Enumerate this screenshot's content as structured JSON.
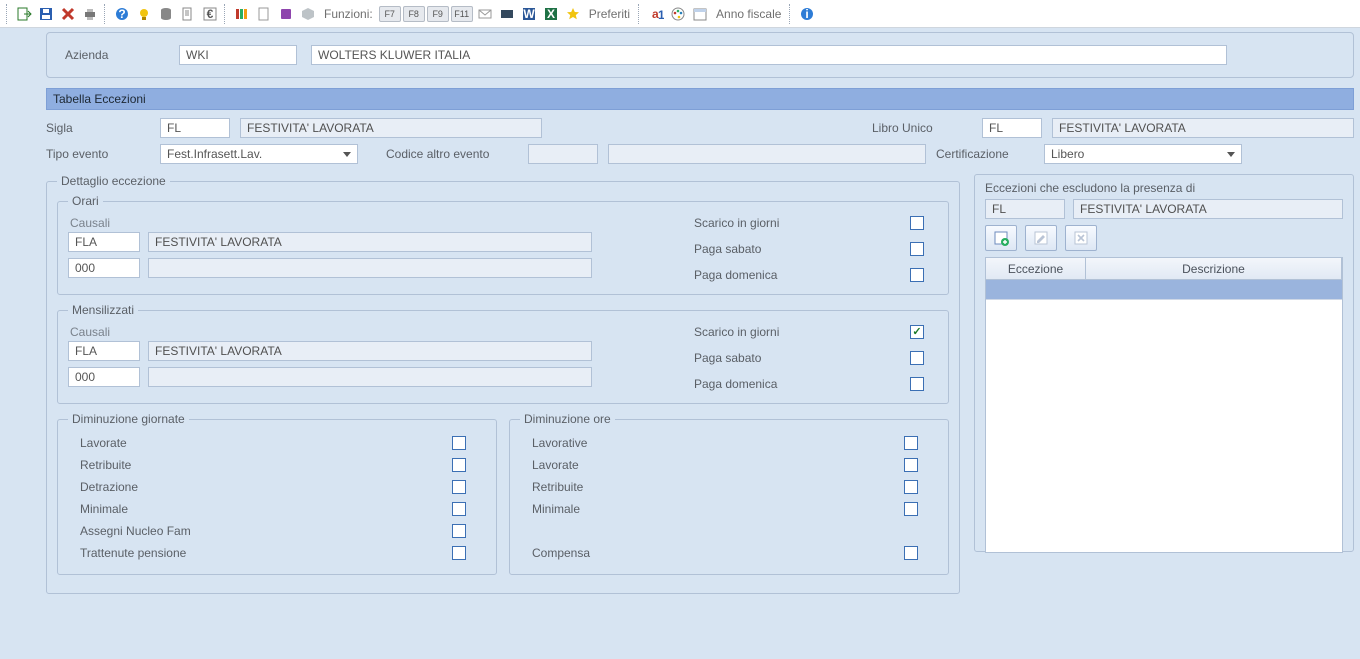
{
  "toolbar": {
    "funzioni_label": "Funzioni:",
    "keys": [
      "F7",
      "F8",
      "F9",
      "F11"
    ],
    "preferiti_label": "Preferiti",
    "anno_fiscale_label": "Anno fiscale"
  },
  "company": {
    "azienda_label": "Azienda",
    "azienda_code": "WKI",
    "azienda_name": "WOLTERS KLUWER ITALIA"
  },
  "section_title": "Tabella Eccezioni",
  "header": {
    "sigla_label": "Sigla",
    "sigla_value": "FL",
    "sigla_desc": "FESTIVITA' LAVORATA",
    "libro_unico_label": "Libro Unico",
    "libro_unico_value": "FL",
    "libro_unico_desc": "FESTIVITA' LAVORATA",
    "tipo_evento_label": "Tipo evento",
    "tipo_evento_value": "Fest.Infrasett.Lav.",
    "codice_altro_label": "Codice altro evento",
    "certificazione_label": "Certificazione",
    "certificazione_value": "Libero"
  },
  "dettaglio": {
    "legend": "Dettaglio eccezione",
    "orari": {
      "legend": "Orari",
      "causali_label": "Causali",
      "row1_code": "FLA",
      "row1_desc": "FESTIVITA' LAVORATA",
      "row2_code": "000",
      "row2_desc": "",
      "scarico_label": "Scarico in giorni",
      "scarico_checked": false,
      "paga_sabato_label": "Paga sabato",
      "paga_sabato_checked": false,
      "paga_domenica_label": "Paga domenica",
      "paga_domenica_checked": false
    },
    "mensilizzati": {
      "legend": "Mensilizzati",
      "causali_label": "Causali",
      "row1_code": "FLA",
      "row1_desc": "FESTIVITA' LAVORATA",
      "row2_code": "000",
      "row2_desc": "",
      "scarico_label": "Scarico in giorni",
      "scarico_checked": true,
      "paga_sabato_label": "Paga sabato",
      "paga_sabato_checked": false,
      "paga_domenica_label": "Paga domenica",
      "paga_domenica_checked": false
    },
    "dim_giornate": {
      "legend": "Diminuzione giornate",
      "items": [
        {
          "label": "Lavorate",
          "checked": false
        },
        {
          "label": "Retribuite",
          "checked": false
        },
        {
          "label": "Detrazione",
          "checked": false
        },
        {
          "label": "Minimale",
          "checked": false
        },
        {
          "label": "Assegni Nucleo Fam",
          "checked": false
        },
        {
          "label": "Trattenute pensione",
          "checked": false
        }
      ]
    },
    "dim_ore": {
      "legend": "Diminuzione ore",
      "items": [
        {
          "label": "Lavorative",
          "checked": false
        },
        {
          "label": "Lavorate",
          "checked": false
        },
        {
          "label": "Retribuite",
          "checked": false
        },
        {
          "label": "Minimale",
          "checked": false
        }
      ],
      "compensa_label": "Compensa",
      "compensa_checked": false
    }
  },
  "esclusioni": {
    "title": "Eccezioni che escludono la presenza di",
    "code": "FL",
    "desc": "FESTIVITA' LAVORATA",
    "col_eccezione": "Eccezione",
    "col_descrizione": "Descrizione"
  }
}
